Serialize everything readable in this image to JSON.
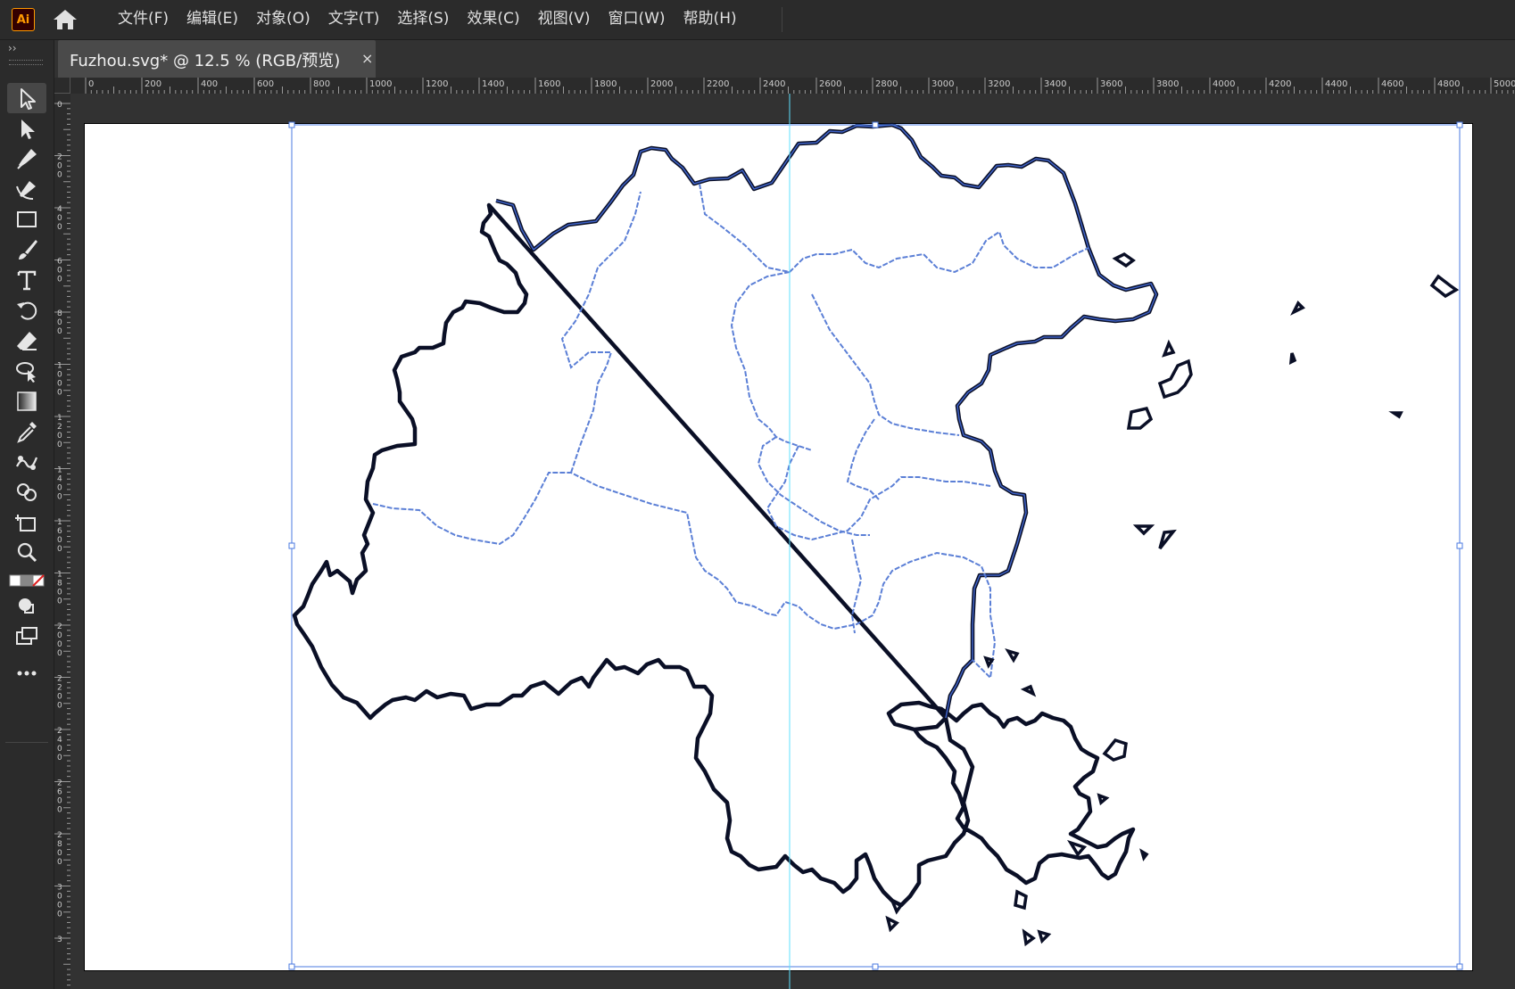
{
  "app": {
    "logo_text": "Ai"
  },
  "menu": [
    "文件(F)",
    "编辑(E)",
    "对象(O)",
    "文字(T)",
    "选择(S)",
    "效果(C)",
    "视图(V)",
    "窗口(W)",
    "帮助(H)"
  ],
  "toolbar": {
    "expand_label": "››",
    "tools": [
      {
        "name": "selection-tool",
        "icon": "arrow-icon",
        "active": true
      },
      {
        "name": "direct-selection-tool",
        "icon": "direct-arrow-icon"
      },
      {
        "name": "pen-tool",
        "icon": "pen-icon"
      },
      {
        "name": "curvature-tool",
        "icon": "curvature-icon"
      },
      {
        "name": "rectangle-tool",
        "icon": "rectangle-icon"
      },
      {
        "name": "paintbrush-tool",
        "icon": "brush-icon"
      },
      {
        "name": "type-tool",
        "icon": "type-icon"
      },
      {
        "name": "rotate-tool",
        "icon": "rotate-icon"
      },
      {
        "name": "eraser-tool",
        "icon": "eraser-icon"
      },
      {
        "name": "puppet-warp-tool",
        "icon": "puppet-warp-icon"
      },
      {
        "name": "gradient-tool",
        "icon": "gradient-icon"
      },
      {
        "name": "eyedropper-tool",
        "icon": "eyedropper-icon"
      },
      {
        "name": "blend-tool",
        "icon": "blend-icon"
      },
      {
        "name": "shape-builder-tool",
        "icon": "shape-builder-icon"
      },
      {
        "name": "artboard-tool",
        "icon": "artboard-icon"
      },
      {
        "name": "zoom-tool",
        "icon": "magnifier-icon"
      },
      {
        "name": "fill-stroke-swatch",
        "icon": "fill-stroke-icon"
      },
      {
        "name": "draw-mode",
        "icon": "draw-mode-icon"
      },
      {
        "name": "screen-mode",
        "icon": "screen-mode-icon"
      },
      {
        "name": "more-tools",
        "icon": "more-icon"
      }
    ]
  },
  "document_tab": {
    "title": "Fuzhou.svg* @ 12.5 % (RGB/预览)",
    "close": "×"
  },
  "rulers": {
    "horizontal": [
      "0",
      "200",
      "400",
      "600",
      "800",
      "1000",
      "1200",
      "1400",
      "1600",
      "1800",
      "2000",
      "2200",
      "2400",
      "2600",
      "2800",
      "3000",
      "3200",
      "3400",
      "3600",
      "3800",
      "4000",
      "4200",
      "4400",
      "4600",
      "4800",
      "5000"
    ],
    "vertical": [
      "0",
      "200",
      "400",
      "600",
      "800",
      "1000",
      "1200",
      "1400",
      "1600",
      "1800",
      "2000",
      "2200",
      "2400",
      "2600",
      "2800",
      "3000",
      "3"
    ]
  },
  "colors": {
    "selection": "#4a78e0",
    "map_outline": "#0a0f26",
    "map_stroke_highlight": "#3f63c8",
    "district_border": "#5b7fd6",
    "guide": "#5fe0ff",
    "artboard": "#ffffff"
  }
}
